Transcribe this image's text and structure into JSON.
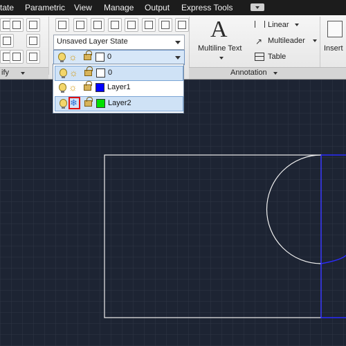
{
  "menu": {
    "items": [
      "tate",
      "Parametric",
      "View",
      "Manage",
      "Output",
      "Express Tools"
    ]
  },
  "ribbon": {
    "modify_panel_label": "ify",
    "layer_state": "Unsaved Layer State",
    "current_layer": "0",
    "annotation": {
      "multiline_text_label": "Multiline Text",
      "linear_label": "Linear",
      "multileader_label": "Multileader",
      "table_label": "Table",
      "panel_label": "Annotation"
    },
    "insert_label": "Insert"
  },
  "layers": [
    {
      "name": "0",
      "color": "#ffffff",
      "frozen": false,
      "selected": true
    },
    {
      "name": "Layer1",
      "color": "#0000ff",
      "frozen": false,
      "selected": false
    },
    {
      "name": "Layer2",
      "color": "#00e000",
      "frozen": true,
      "selected": true
    }
  ],
  "colors": {
    "canvas_bg": "#1d2433",
    "grid": "#2e3645",
    "rectangle_stroke": "#f0f0f0",
    "blue_shape_stroke": "#2b2bff",
    "highlight_box": "#e01010"
  },
  "icons": {
    "bulb": "lightbulb-icon",
    "sun": "thawed-sun-icon",
    "snowflake": "frozen-snowflake-icon",
    "lock": "unlocked-padlock-icon"
  }
}
